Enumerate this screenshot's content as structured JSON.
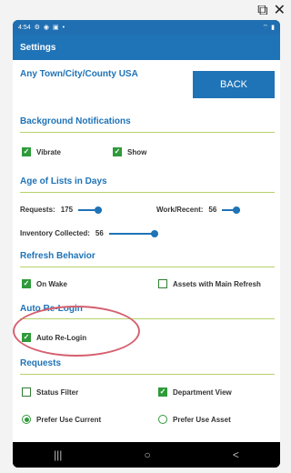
{
  "window": {
    "popout_icon": "popout-icon",
    "close_icon": "close-icon",
    "popout_glyph": "⧉",
    "close_glyph": "✕"
  },
  "status_bar": {
    "time": "4:54",
    "left_icons": [
      "notification-icon",
      "notification-icon",
      "notification-icon"
    ],
    "right_icons": [
      "wifi-icon",
      "battery-icon"
    ]
  },
  "app_bar": {
    "title": "Settings"
  },
  "header": {
    "location": "Any Town/City/County USA",
    "back_label": "BACK"
  },
  "sections": {
    "background": {
      "title": "Background Notifications",
      "vibrate": {
        "label": "Vibrate",
        "checked": true
      },
      "show": {
        "label": "Show",
        "checked": true
      }
    },
    "age": {
      "title": "Age of Lists in Days",
      "requests": {
        "label": "Requests:",
        "value": "175"
      },
      "work_recent": {
        "label": "Work/Recent:",
        "value": "56"
      },
      "inventory": {
        "label": "Inventory Collected:",
        "value": "56"
      }
    },
    "refresh": {
      "title": "Refresh Behavior",
      "on_wake": {
        "label": "On Wake",
        "checked": true
      },
      "assets_main": {
        "label": "Assets with Main Refresh",
        "checked": false
      }
    },
    "relogin": {
      "title": "Auto Re-Login",
      "auto_relogin": {
        "label": "Auto Re-Login",
        "checked": true
      }
    },
    "requests": {
      "title": "Requests",
      "status_filter": {
        "label": "Status Filter",
        "checked": false
      },
      "department_view": {
        "label": "Department View",
        "checked": true
      },
      "prefer_use_current": {
        "label": "Prefer Use Current",
        "selected": true
      },
      "prefer_use_asset": {
        "label": "Prefer Use Asset",
        "selected": false
      }
    }
  },
  "nav": {
    "recents": "|||",
    "home": "○",
    "back": "<"
  },
  "colors": {
    "accent": "#1f73b7",
    "check": "#2f9a3a",
    "divider": "#b6d26a",
    "annotation": "#d5606f"
  }
}
